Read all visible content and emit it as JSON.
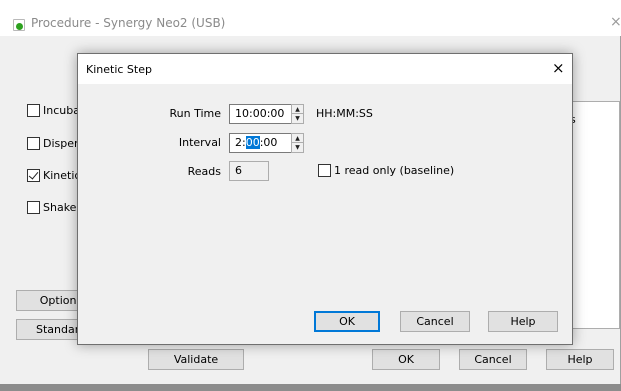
{
  "parent_window": {
    "title": "Procedure - Synergy Neo2 (USB)",
    "close_glyph": "×",
    "actions": [
      {
        "label": "Incubate",
        "checked": false
      },
      {
        "label": "Dispense",
        "checked": false
      },
      {
        "label": "Kinetic",
        "checked": true
      },
      {
        "label": "Shake",
        "checked": false
      }
    ],
    "step_list_header": "s",
    "options_button": "Options",
    "standard_button": "Standard",
    "buttons": {
      "validate": "Validate",
      "ok": "OK",
      "cancel": "Cancel",
      "help": "Help"
    }
  },
  "dialog": {
    "title": "Kinetic Step",
    "close_glyph": "×",
    "run_time": {
      "label": "Run Time",
      "value": "10:00:00",
      "unit": "HH:MM:SS"
    },
    "interval": {
      "label": "Interval",
      "value_prefix": "2:",
      "value_selected": "00",
      "value_suffix": ":00"
    },
    "reads": {
      "label": "Reads",
      "value": "6"
    },
    "one_read_only": {
      "label": "1 read only (baseline)",
      "checked": false
    },
    "buttons": {
      "ok": "OK",
      "cancel": "Cancel",
      "help": "Help"
    }
  },
  "icons": {
    "app": "synergy-app-icon",
    "spin_up": "▲",
    "spin_down": "▼"
  }
}
